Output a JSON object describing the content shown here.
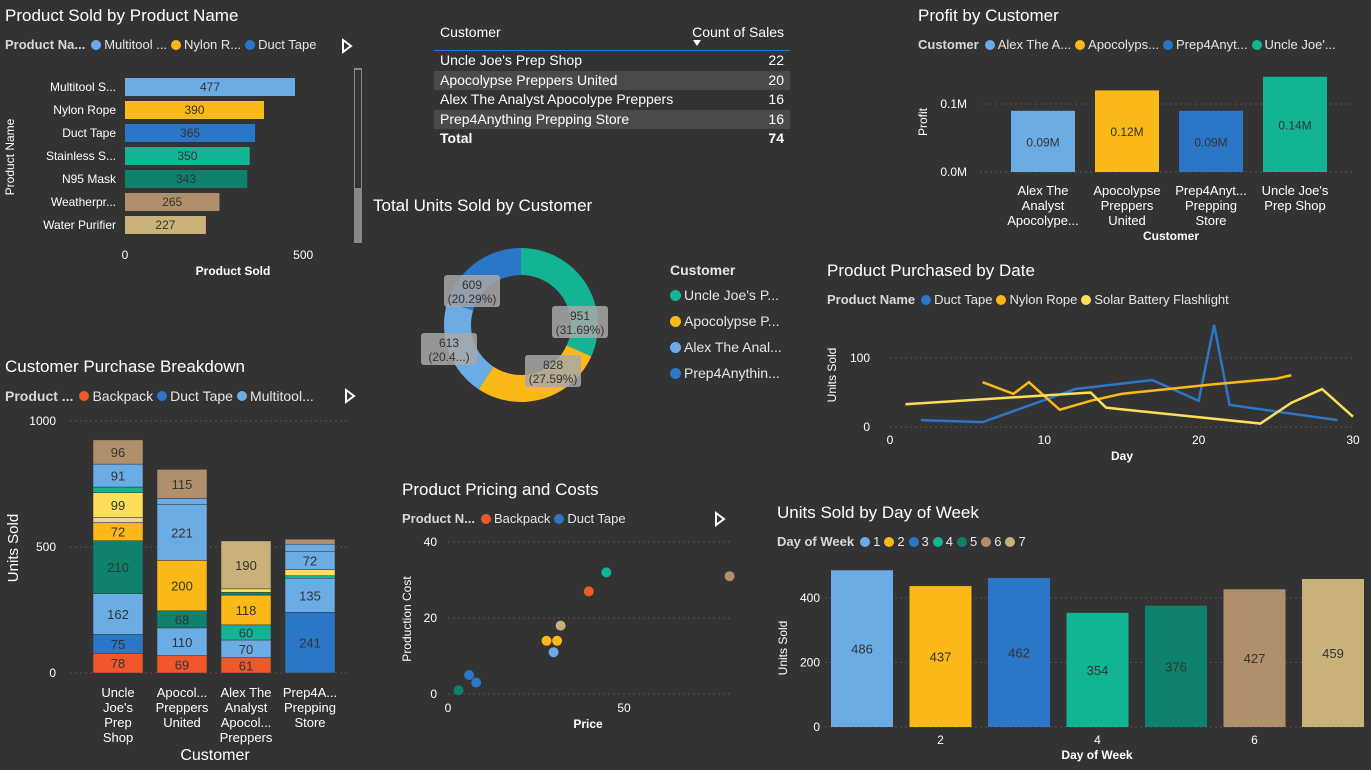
{
  "colors": {
    "c1": "#6cace4",
    "c2": "#fbb917",
    "c3": "#2b76c6",
    "c4": "#13b494",
    "c5": "#0e826d",
    "c6": "#b0906b",
    "c7": "#c8b27a",
    "orange": "#f0582c",
    "yellow": "#fbdf5a",
    "bg": "#333333"
  },
  "productSold": {
    "title": "Product Sold by Product Name",
    "legend_title": "Product Na...",
    "legend": [
      "Multitool ...",
      "Nylon R...",
      "Duct Tape"
    ],
    "ylabel": "Product Name",
    "xlabel": "Product Sold",
    "ticks": [
      "0",
      "500"
    ]
  },
  "salesTable": {
    "headers": [
      "Customer",
      "Count of Sales"
    ],
    "rows": [
      [
        "Uncle Joe's Prep Shop",
        "22"
      ],
      [
        "Apocolypse Preppers United",
        "20"
      ],
      [
        "Alex The Analyst Apocolype Preppers",
        "16"
      ],
      [
        "Prep4Anything Prepping Store",
        "16"
      ]
    ],
    "total": [
      "Total",
      "74"
    ]
  },
  "profit": {
    "title": "Profit by Customer",
    "legend_title": "Customer",
    "legend": [
      "Alex The A...",
      "Apocolyps...",
      "Prep4Anyt...",
      "Uncle Joe'..."
    ],
    "ylabel": "Profit",
    "xlabel": "Customer",
    "yticks": [
      "0.0M",
      "0.1M"
    ],
    "cats": [
      [
        "Alex The",
        "Analyst",
        "Apocolype..."
      ],
      [
        "Apocolypse",
        "Preppers",
        "United"
      ],
      [
        "Prep4Anyt...",
        "Prepping",
        "Store"
      ],
      [
        "Uncle Joe's",
        "Prep Shop"
      ]
    ]
  },
  "donut": {
    "title": "Total Units Sold by Customer",
    "legend_title": "Customer",
    "legend": [
      "Uncle Joe's P...",
      "Apocolypse P...",
      "Alex The Anal...",
      "Prep4Anythin..."
    ],
    "labels": [
      [
        "951",
        "(31.69%)"
      ],
      [
        "828",
        "(27.59%)"
      ],
      [
        "613",
        "(20.4...)"
      ],
      [
        "609",
        "(20.29%)"
      ]
    ]
  },
  "byDate": {
    "title": "Product Purchased by Date",
    "legend_title": "Product Name",
    "legend": [
      "Duct Tape",
      "Nylon Rope",
      "Solar Battery Flashlight"
    ],
    "ylabel": "Units Sold",
    "xlabel": "Day",
    "yticks": [
      "0",
      "100"
    ],
    "xticks": [
      "0",
      "10",
      "20",
      "30"
    ]
  },
  "breakdown": {
    "title": "Customer Purchase Breakdown",
    "legend_title": "Product ...",
    "legend": [
      "Backpack",
      "Duct Tape",
      "Multitool..."
    ],
    "ylabel": "Units Sold",
    "xlabel": "Customer",
    "yticks": [
      "0",
      "500",
      "1000"
    ],
    "cats": [
      [
        "Uncle",
        "Joe's",
        "Prep",
        "Shop"
      ],
      [
        "Apocol...",
        "Preppers",
        "United"
      ],
      [
        "Alex The",
        "Analyst",
        "Apocol...",
        "Preppers"
      ],
      [
        "Prep4A...",
        "Prepping",
        "Store"
      ]
    ]
  },
  "pricing": {
    "title": "Product Pricing and Costs",
    "legend_title": "Product N...",
    "legend": [
      "Backpack",
      "Duct Tape"
    ],
    "ylabel": "Production Cost",
    "xlabel": "Price",
    "yticks": [
      "0",
      "20",
      "40"
    ],
    "xticks": [
      "0",
      "50"
    ]
  },
  "dow": {
    "title": "Units Sold by Day of Week",
    "legend_title": "Day of Week",
    "legend": [
      "1",
      "2",
      "3",
      "4",
      "5",
      "6",
      "7"
    ],
    "ylabel": "Units Sold",
    "xlabel": "Day of Week",
    "yticks": [
      "0",
      "200",
      "400"
    ],
    "xticks": [
      "2",
      "4",
      "6"
    ]
  },
  "chart_data": [
    {
      "type": "bar",
      "orientation": "horizontal",
      "title": "Product Sold by Product Name",
      "categories": [
        "Multitool S...",
        "Nylon Rope",
        "Duct Tape",
        "Stainless S...",
        "N95 Mask",
        "Weatherpr...",
        "Water Purifier"
      ],
      "values": [
        477,
        390,
        365,
        350,
        343,
        265,
        227
      ],
      "xlabel": "Product Sold",
      "ylabel": "Product Name",
      "xlim": [
        0,
        560
      ]
    },
    {
      "type": "table",
      "title": "",
      "columns": [
        "Customer",
        "Count of Sales"
      ],
      "rows": [
        [
          "Uncle Joe's Prep Shop",
          22
        ],
        [
          "Apocolypse Preppers United",
          20
        ],
        [
          "Alex The Analyst Apocolype Preppers",
          16
        ],
        [
          "Prep4Anything Prepping Store",
          16
        ]
      ],
      "total": 74
    },
    {
      "type": "bar",
      "title": "Profit by Customer",
      "categories": [
        "Alex The Analyst Apocolype...",
        "Apocolypse Preppers United",
        "Prep4Anyt... Prepping Store",
        "Uncle Joe's Prep Shop"
      ],
      "values": [
        0.09,
        0.12,
        0.09,
        0.14
      ],
      "data_labels": [
        "0.09M",
        "0.12M",
        "0.09M",
        "0.14M"
      ],
      "xlabel": "Customer",
      "ylabel": "Profit",
      "ylim": [
        0,
        0.145
      ]
    },
    {
      "type": "pie",
      "title": "Total Units Sold by Customer",
      "categories": [
        "Uncle Joe's P...",
        "Apocolypse P...",
        "Alex The Anal...",
        "Prep4Anythin..."
      ],
      "values": [
        951,
        828,
        613,
        609
      ],
      "percent_labels": [
        "31.69%",
        "27.59%",
        "20.4...",
        "20.29%"
      ]
    },
    {
      "type": "line",
      "title": "Product Purchased by Date",
      "xlabel": "Day",
      "ylabel": "Units Sold",
      "xlim": [
        0,
        30
      ],
      "ylim": [
        0,
        150
      ],
      "series": [
        {
          "name": "Duct Tape",
          "x": [
            2,
            6,
            12,
            17,
            20,
            21,
            22,
            29
          ],
          "y": [
            10,
            7,
            55,
            68,
            38,
            148,
            32,
            10
          ]
        },
        {
          "name": "Nylon Rope",
          "x": [
            6,
            8,
            9,
            11,
            13,
            15,
            21,
            25,
            26
          ],
          "y": [
            65,
            48,
            65,
            25,
            38,
            48,
            62,
            70,
            75
          ]
        },
        {
          "name": "Solar Battery Flashlight",
          "x": [
            1,
            13,
            14,
            24,
            26,
            28,
            30
          ],
          "y": [
            33,
            50,
            28,
            5,
            35,
            55,
            15
          ]
        }
      ]
    },
    {
      "type": "bar",
      "stacked": true,
      "title": "Customer Purchase Breakdown",
      "categories": [
        "Uncle Joe's Prep Shop",
        "Apocol... Preppers United",
        "Alex The Analyst Apocol... Preppers",
        "Prep4A... Prepping Store"
      ],
      "series": [
        {
          "name": "Backpack",
          "values": [
            78,
            69,
            61,
            0
          ]
        },
        {
          "name": "Duct Tape",
          "values": [
            75,
            0,
            0,
            241
          ]
        },
        {
          "name": "Multitool...",
          "values": [
            162,
            110,
            70,
            135
          ]
        },
        {
          "name": "",
          "values": [
            210,
            68,
            0,
            0
          ]
        },
        {
          "name": "",
          "values": [
            0,
            0,
            60,
            0
          ]
        },
        {
          "name": "",
          "values": [
            72,
            200,
            118,
            0
          ]
        },
        {
          "name": "",
          "values": [
            99,
            0,
            0,
            0
          ]
        },
        {
          "name": "",
          "values": [
            0,
            0,
            190,
            0
          ]
        },
        {
          "name": "",
          "values": [
            91,
            221,
            0,
            72
          ]
        },
        {
          "name": "",
          "values": [
            96,
            115,
            0,
            0
          ]
        }
      ],
      "xlabel": "Customer",
      "ylabel": "Units Sold",
      "ylim": [
        0,
        1000
      ]
    },
    {
      "type": "scatter",
      "title": "Product Pricing and Costs",
      "xlabel": "Price",
      "ylabel": "Production Cost",
      "xlim": [
        0,
        80
      ],
      "ylim": [
        0,
        40
      ],
      "series": [
        {
          "name": "Backpack",
          "x": [
            40
          ],
          "y": [
            27
          ]
        },
        {
          "name": "Duct Tape",
          "x": [
            6
          ],
          "y": [
            5
          ]
        },
        {
          "name": "",
          "x": [
            8,
            30,
            28,
            31,
            32,
            45,
            3,
            80
          ],
          "y": [
            3,
            11,
            14,
            14,
            18,
            32,
            1,
            31
          ]
        }
      ]
    },
    {
      "type": "bar",
      "title": "Units Sold by Day of Week",
      "categories": [
        "1",
        "2",
        "3",
        "4",
        "5",
        "6",
        "7"
      ],
      "values": [
        486,
        437,
        462,
        354,
        376,
        427,
        459
      ],
      "xlabel": "Day of Week",
      "ylabel": "Units Sold",
      "ylim": [
        0,
        500
      ]
    }
  ]
}
